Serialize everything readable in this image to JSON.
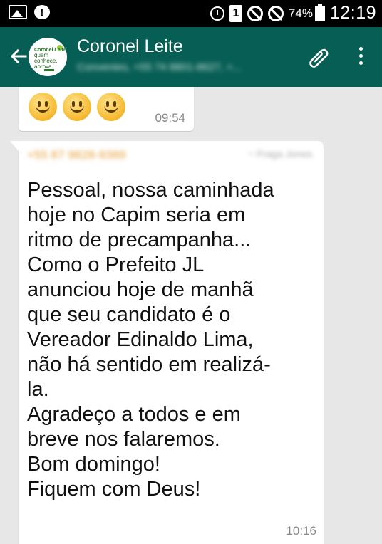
{
  "status_bar": {
    "battery_percent": "74%",
    "sim_label": "1",
    "clock": "12:19",
    "notification_badge": "!"
  },
  "header": {
    "contact_name": "Coronel Leite",
    "subtitle": "Convenies, +55 74 8801-8627, +...",
    "avatar_text_top": "Coronel Leite",
    "avatar_text_main": "quem conhece, aprova."
  },
  "messages": [
    {
      "type": "emoji",
      "emojis": [
        "smile",
        "smile",
        "smile"
      ],
      "time": "09:54"
    },
    {
      "type": "text",
      "sender": "+55 87 9828-9389",
      "sender_time": "~ Fraga Jones",
      "text": "Pessoal, nossa caminhada\nhoje no Capim seria em\nritmo de precampanha...\nComo o Prefeito JL\nanunciou hoje de manhã\nque seu candidato é o\nVereador Edinaldo Lima,\nnão há sentido em realizá-\nla.\nAgradeço a todos e em\nbreve nos falaremos.\nBom domingo!\nFiquem com Deus!",
      "time": "10:16"
    }
  ],
  "colors": {
    "app_bar": "#075e54",
    "chat_background": "#e7e7e7",
    "sender_name": "#e6a13a"
  }
}
